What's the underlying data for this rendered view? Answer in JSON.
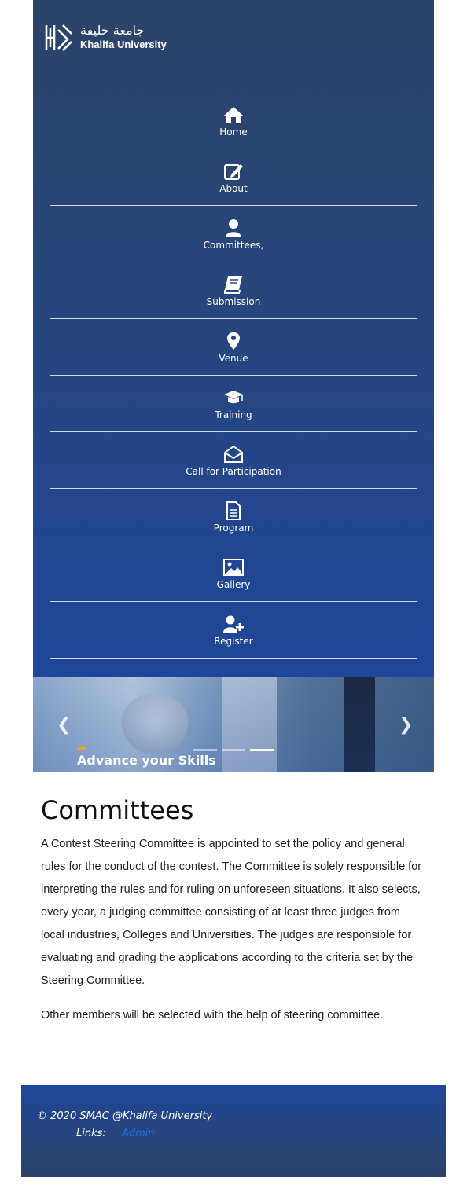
{
  "header": {
    "logo_arabic": "جامعة خليفة",
    "logo_english": "Khalifa University"
  },
  "nav": {
    "items": [
      {
        "label": "Home",
        "icon": "home-icon"
      },
      {
        "label": "About",
        "icon": "edit-icon"
      },
      {
        "label": "Committees,",
        "icon": "user-icon"
      },
      {
        "label": "Submission",
        "icon": "book-icon"
      },
      {
        "label": "Venue",
        "icon": "map-marker-icon"
      },
      {
        "label": "Training",
        "icon": "graduation-cap-icon"
      },
      {
        "label": "Call for Participation",
        "icon": "envelope-open-icon"
      },
      {
        "label": "Program",
        "icon": "file-text-icon"
      },
      {
        "label": "Gallery",
        "icon": "image-icon"
      },
      {
        "label": "Register",
        "icon": "user-plus-icon"
      }
    ]
  },
  "carousel": {
    "caption": "Advance your Skills",
    "prev_glyph": "❮",
    "next_glyph": "❯",
    "slide_count": 3,
    "active_slide": 3
  },
  "main": {
    "title": "Committees",
    "paragraph1": "A Contest Steering Committee is appointed to set the policy and general rules for the conduct of the contest. The Committee is solely responsible for interpreting the rules and for ruling on unforeseen situations. It also selects, every year, a judging committee consisting of at least three judges from local industries, Colleges and Universities. The judges are responsible for evaluating and grading the applications according to the criteria set by the Steering Committee.",
    "paragraph2": "Other members will be selected with the help of steering committee."
  },
  "footer": {
    "copyright": "© 2020 SMAC @Khalifa University",
    "links_label": "Links:",
    "admin_link": "Admin"
  },
  "colors": {
    "header_top": "#2c4468",
    "header_bottom": "#1f469a",
    "link_blue": "#1e73e0",
    "accent_orange": "#f0a030"
  }
}
